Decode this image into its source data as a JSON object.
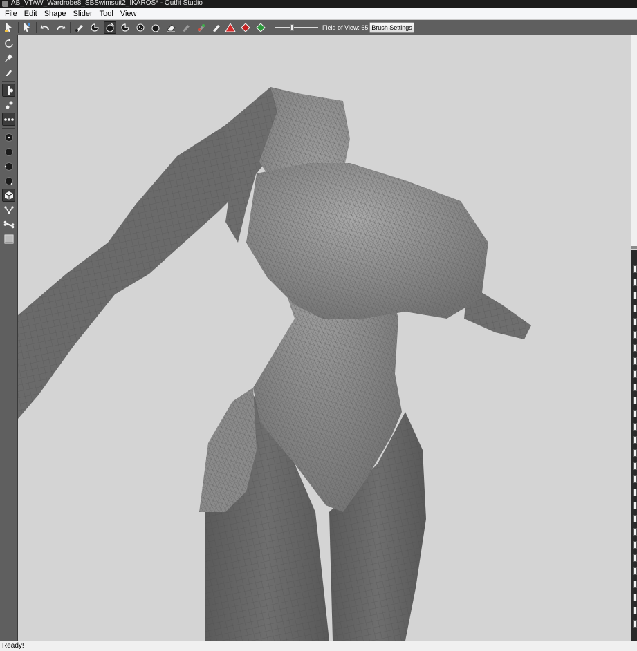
{
  "window": {
    "title": "AB_VTAW_Wardrobe8_SBSwimsuit2_IKAROS* - Outfit Studio",
    "app_icon": "outfit-studio-icon"
  },
  "menu": {
    "items": [
      {
        "id": "file",
        "label": "File"
      },
      {
        "id": "edit",
        "label": "Edit"
      },
      {
        "id": "shape",
        "label": "Shape"
      },
      {
        "id": "slider",
        "label": "Slider"
      },
      {
        "id": "tool",
        "label": "Tool"
      },
      {
        "id": "view",
        "label": "View"
      }
    ]
  },
  "toolbar": {
    "buttons": [
      {
        "name": "select-brush-icon",
        "active": false
      },
      {
        "name": "transform-brush-icon",
        "active": false
      },
      {
        "name": "undo-icon",
        "active": false
      },
      {
        "name": "redo-icon",
        "active": false
      },
      {
        "name": "mask-brush-icon",
        "active": false
      },
      {
        "name": "inflate-brush-icon",
        "active": false
      },
      {
        "name": "deflate-brush-icon",
        "active": true
      },
      {
        "name": "move-brush-icon",
        "active": false
      },
      {
        "name": "smooth-brush-icon",
        "active": false
      },
      {
        "name": "weight-brush-icon",
        "active": false
      },
      {
        "name": "eraser-icon",
        "active": false
      },
      {
        "name": "color-brush-icon",
        "active": false
      },
      {
        "name": "alpha-brush-icon",
        "active": false
      },
      {
        "name": "paint-brush-icon",
        "active": false
      },
      {
        "name": "red-triangle-icon",
        "active": false
      },
      {
        "name": "red-diamond-icon",
        "active": false
      },
      {
        "name": "green-diamond-icon",
        "active": false
      }
    ],
    "field_of_view": {
      "label": "Field of View: 65",
      "value": 65,
      "min": 10,
      "max": 150
    },
    "brush_settings_label": "Brush Settings"
  },
  "left_toolbar": {
    "buttons": [
      {
        "name": "rotate-view-icon",
        "active": false
      },
      {
        "name": "pin-icon",
        "active": false
      },
      {
        "name": "pencil-icon",
        "active": false
      },
      {
        "name": "symmetry-x-icon",
        "active": true
      },
      {
        "name": "symmetry-y-icon",
        "active": false
      },
      {
        "name": "symmetry-z-icon",
        "active": true
      },
      {
        "name": "brush-size-small-icon",
        "active": false
      },
      {
        "name": "brush-size-medium-icon",
        "active": false
      },
      {
        "name": "brush-size-large-icon",
        "active": false
      },
      {
        "name": "brush-size-xlarge-icon",
        "active": false
      },
      {
        "name": "cube-view-icon",
        "active": true
      },
      {
        "name": "vertex-edit-icon",
        "active": false
      },
      {
        "name": "bone-icon",
        "active": false
      },
      {
        "name": "wireframe-grid-icon",
        "active": false
      }
    ]
  },
  "viewport": {
    "description_name": "3d-viewport",
    "background_color": "#d4d4d4",
    "mesh_color": "#8a8a8a",
    "wireframe_color": "#5a5a5a"
  },
  "status": {
    "text": "Ready!"
  }
}
